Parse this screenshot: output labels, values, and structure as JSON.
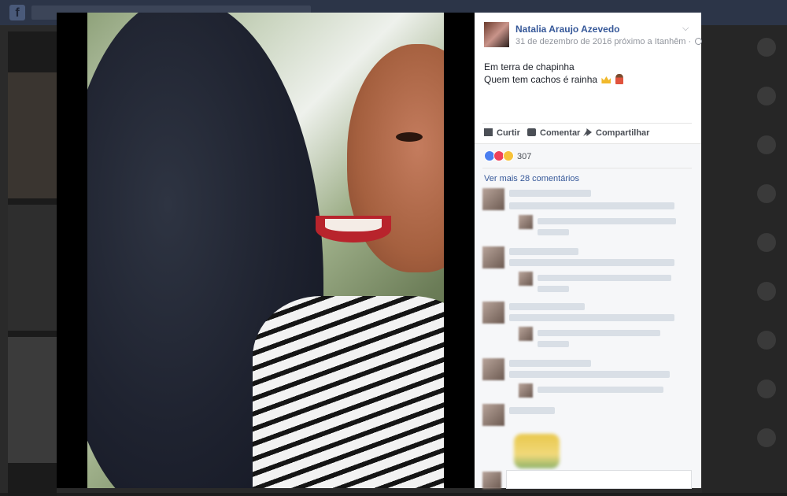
{
  "post": {
    "author": "Natalia Araujo Azevedo",
    "meta": "31 de dezembro de 2016 próximo a Itanhêm ·",
    "line1": "Em terra de chapinha",
    "line2": "Quem tem cachos é rainha",
    "icons": [
      "avatar",
      "globe-icon",
      "chevron-down-icon",
      "crown-emoji",
      "dancer-emoji"
    ]
  },
  "actions": {
    "like": "Curtir",
    "comment": "Comentar",
    "share": "Compartilhar"
  },
  "reactions": {
    "count": "307",
    "types": [
      "like-icon",
      "love-icon",
      "wow-icon"
    ],
    "colors": {
      "like": "#4a7ef0",
      "love": "#f0425a",
      "wow": "#f7c23a"
    }
  },
  "comments": {
    "more_link": "Ver mais 28 comentários"
  },
  "colors": {
    "link": "#365899",
    "text": "#1d2129",
    "muted": "#90949c",
    "topbar": "#2c3548"
  }
}
